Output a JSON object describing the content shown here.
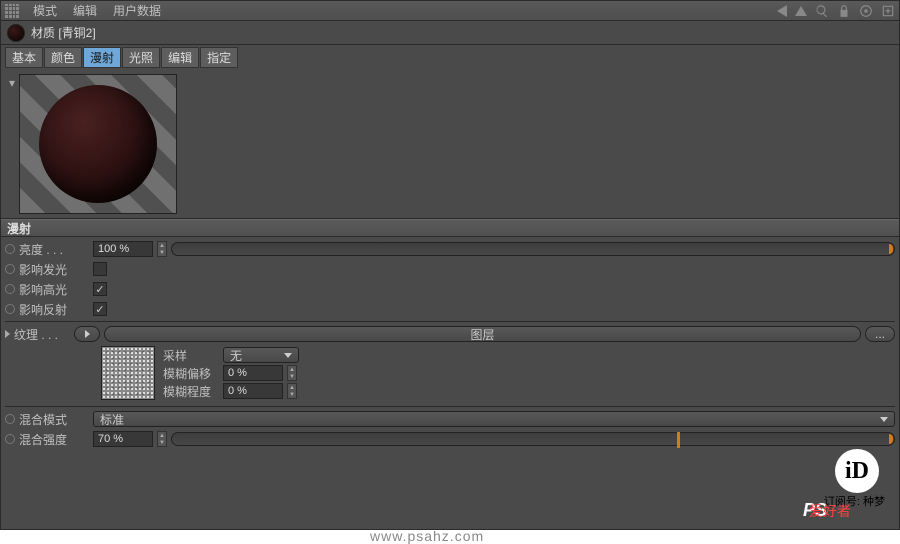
{
  "menu": {
    "mode": "模式",
    "edit": "编辑",
    "userdata": "用户数据"
  },
  "title": "材质 [青铜2]",
  "tabs": {
    "basic": "基本",
    "color": "颜色",
    "diffuse": "漫射",
    "luminance": "光照",
    "editing": "编辑",
    "assign": "指定"
  },
  "section_diffuse": "漫射",
  "params": {
    "brightness_label": "亮度 . . .",
    "brightness_value": "100 %",
    "affect_luminance": "影响发光",
    "affect_luminance_checked": false,
    "affect_specular": "影响高光",
    "affect_specular_checked": true,
    "affect_reflection": "影响反射",
    "affect_reflection_checked": true
  },
  "texture": {
    "label": "纹理 . . .",
    "layer_btn": "图层",
    "dots": "...",
    "sample_label": "采样",
    "sample_value": "无",
    "blur_offset_label": "模糊偏移",
    "blur_offset_value": "0 %",
    "blur_scale_label": "模糊程度",
    "blur_scale_value": "0 %"
  },
  "mix": {
    "mode_label": "混合模式",
    "mode_value": "标准",
    "strength_label": "混合强度",
    "strength_value": "70 %"
  },
  "watermark": {
    "logo": "iD",
    "sub": "订阅号: 种梦",
    "site": "www.psahz.com",
    "ps": "PS",
    "ah": "爱好者"
  }
}
